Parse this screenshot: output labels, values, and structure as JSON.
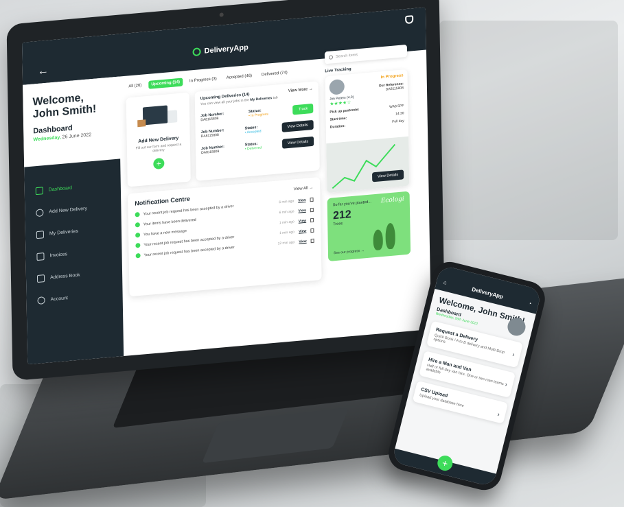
{
  "app": {
    "brand": "DeliveryApp"
  },
  "colors": {
    "accent": "#3ddc5a",
    "dark": "#1e2a32",
    "warning": "#f3a21a",
    "info": "#28b7e0"
  },
  "sidebar": {
    "welcome": "Welcome, John Smith!",
    "dashboard": "Dashboard",
    "date_day": "Wednesday,",
    "date_rest": "26 June 2022",
    "items": [
      {
        "label": "Dashboard",
        "icon": "home-icon"
      },
      {
        "label": "Add New Delivery",
        "icon": "plus-circle-icon"
      },
      {
        "label": "My Deliveries",
        "icon": "box-icon"
      },
      {
        "label": "Invoices",
        "icon": "invoice-icon"
      },
      {
        "label": "Address Book",
        "icon": "book-icon"
      },
      {
        "label": "Account",
        "icon": "gear-icon"
      }
    ]
  },
  "tabs": [
    {
      "label": "All (26)"
    },
    {
      "label": "Upcoming (14)"
    },
    {
      "label": "In Progress (3)"
    },
    {
      "label": "Accepted (46)"
    },
    {
      "label": "Delivered (74)"
    }
  ],
  "add_card": {
    "title": "Add New Delivery",
    "subtitle": "Fill out our form and request a delivery",
    "plus": "+"
  },
  "deliveries": {
    "title": "Upcoming Deliveries (14)",
    "subtitle_pre": "You can view all your jobs in the",
    "subtitle_link": "My Deliveries",
    "subtitle_post": "tab",
    "view_more": "View More →",
    "job_label": "Job Number:",
    "status_label": "Status:",
    "rows": [
      {
        "job": "DA8115808",
        "status": "• In Progress",
        "action": "Track"
      },
      {
        "job": "DA8115808",
        "status": "• Accepted",
        "action": "View Details"
      },
      {
        "job": "DA8115808",
        "status": "• Delivered",
        "action": "View Details"
      }
    ]
  },
  "notifications": {
    "title": "Notification Centre",
    "view_all": "View All →",
    "view_label": "View",
    "rows": [
      {
        "text": "Your recent job request has been accepted by a driver",
        "time": "6 min ago"
      },
      {
        "text": "Your items have been delivered",
        "time": "6 min ago"
      },
      {
        "text": "You have a new message",
        "time": "1 min ago"
      },
      {
        "text": "Your recent job request has been accepted by a driver",
        "time": "1 min ago"
      },
      {
        "text": "Your recent job request has been accepted by a driver",
        "time": "12 min ago"
      }
    ]
  },
  "search": {
    "placeholder": "Search items"
  },
  "tracking": {
    "label": "Live Tracking",
    "status": "In Progress",
    "driver": "Jim Peters (4.0)",
    "stars": "★★★★☆",
    "ref_label": "Our Reference:",
    "ref": "DA8115808",
    "rows": [
      {
        "k": "Pick up postcode:",
        "v": "WA8 5PF"
      },
      {
        "k": "Start time:",
        "v": "14:30"
      },
      {
        "k": "Duration:",
        "v": "Full day"
      }
    ],
    "map_button": "View Details"
  },
  "eco": {
    "small": "So far you've planted...",
    "number": "212",
    "label": "Trees",
    "link": "See our progress →",
    "brand": "Ecologi"
  },
  "phone": {
    "brand": "DeliveryApp",
    "welcome": "Welcome, John Smith!",
    "dashboard": "Dashboard",
    "date": "Wednesday, 26th June 2022",
    "cards": [
      {
        "title": "Request a Delivery",
        "sub": "Quick Book / A to B delivery and Multi-Drop options"
      },
      {
        "title": "Hire a Man and Van",
        "sub": "Half or full day van hire. One or two man teams available"
      },
      {
        "title": "CSV Upload",
        "sub": "Upload your database here"
      }
    ],
    "plus": "+"
  }
}
